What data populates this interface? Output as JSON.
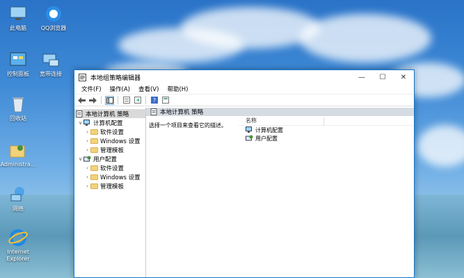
{
  "desktop": {
    "icons": [
      {
        "label": "此电脑",
        "icon": "computer-icon"
      },
      {
        "label": "QQ浏览器",
        "icon": "qq-browser-icon"
      },
      {
        "label": "控制面板",
        "icon": "control-panel-icon"
      },
      {
        "label": "宽带连接",
        "icon": "broadband-icon"
      },
      {
        "label": "回收站",
        "icon": "recycle-bin-icon"
      },
      {
        "label": "Administra...",
        "icon": "user-folder-icon"
      },
      {
        "label": "网络",
        "icon": "network-icon"
      },
      {
        "label": "Internet Explorer",
        "icon": "ie-icon"
      }
    ]
  },
  "window": {
    "title": "本地组策略编辑器",
    "minimize": "—",
    "maximize": "☐",
    "close": "✕",
    "menu": [
      "文件(F)",
      "操作(A)",
      "查看(V)",
      "帮助(H)"
    ]
  },
  "tree": {
    "root": "本地计算机 策略",
    "computer_config": "计算机配置",
    "user_config": "用户配置",
    "software_settings": "软件设置",
    "windows_settings": "Windows 设置",
    "admin_templates": "管理模板"
  },
  "right": {
    "header": "本地计算机 策略",
    "description": "选择一个项目来查看它的描述。",
    "column_name": "名称",
    "items": [
      "计算机配置",
      "用户配置"
    ]
  }
}
